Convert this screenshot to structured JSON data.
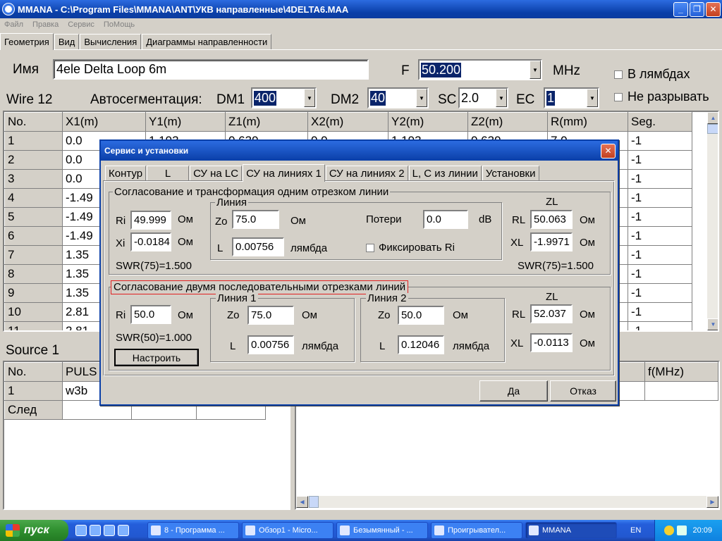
{
  "window": {
    "title": "MMANA - C:\\Program Files\\MMANA\\ANT\\УКВ направленные\\4DELTA6.MAA"
  },
  "menu": [
    "Файл",
    "Правка",
    "Сервис",
    "ПоМощь"
  ],
  "tabs": [
    "Геометрия",
    "Вид",
    "Вычисления",
    "Диаграммы направленности"
  ],
  "geometry": {
    "name_label": "Имя",
    "name_value": "4ele Delta Loop 6m",
    "f_label": "F",
    "f_value": "50.200",
    "f_unit": "MHz",
    "lambda_check": "В лямбдах",
    "nobreak_check": "Не разрывать",
    "wire_label": "Wire 12",
    "autoseg_label": "Автосегментация:",
    "dm1_label": "DM1",
    "dm1_value": "400",
    "dm2_label": "DM2",
    "dm2_value": "40",
    "sc_label": "SC",
    "sc_value": "2.0",
    "ec_label": "EC",
    "ec_value": "1"
  },
  "wire_table": {
    "headers": [
      "No.",
      "X1(m)",
      "Y1(m)",
      "Z1(m)",
      "X2(m)",
      "Y2(m)",
      "Z2(m)",
      "R(mm)",
      "Seg."
    ],
    "rows": [
      [
        "1",
        "0.0",
        "1.193",
        "0.639",
        "0.0",
        "1.193",
        "0.639",
        "7.0",
        "-1"
      ],
      [
        "2",
        "0.0",
        "",
        "",
        "",
        "",
        "",
        "",
        "-1"
      ],
      [
        "3",
        "0.0",
        "",
        "",
        "",
        "",
        "",
        "",
        "-1"
      ],
      [
        "4",
        "-1.49",
        "",
        "",
        "",
        "",
        "",
        "",
        "-1"
      ],
      [
        "5",
        "-1.49",
        "",
        "",
        "",
        "",
        "",
        "",
        "-1"
      ],
      [
        "6",
        "-1.49",
        "",
        "",
        "",
        "",
        "",
        "",
        "-1"
      ],
      [
        "7",
        "1.35",
        "",
        "",
        "",
        "",
        "",
        "",
        "-1"
      ],
      [
        "8",
        "1.35",
        "",
        "",
        "",
        "",
        "",
        "",
        "-1"
      ],
      [
        "9",
        "1.35",
        "",
        "",
        "",
        "",
        "",
        "",
        "-1"
      ],
      [
        "10",
        "2.81",
        "",
        "",
        "",
        "",
        "",
        "",
        "-1"
      ],
      [
        "11",
        "2.81",
        "",
        "",
        "",
        "",
        "",
        "",
        "-1"
      ]
    ]
  },
  "source": {
    "label": "Source 1",
    "headers": [
      "No.",
      "PULS"
    ],
    "rows": [
      [
        "1",
        "w3b"
      ]
    ],
    "next_label": "След"
  },
  "load_table": {
    "header_right": "f(MHz)"
  },
  "dialog": {
    "title": "Сервис и установки",
    "tabs": [
      "Контур",
      "L",
      "СУ на LC",
      "СУ на линиях 1",
      "СУ на линиях 2",
      "L, C из линии",
      "Установки"
    ],
    "group1": {
      "title": "Согласование и  трансформация одним отрезком линии",
      "ri_label": "Ri",
      "ri_value": "49.999",
      "ri_unit": "Ом",
      "xi_label": "Xi",
      "xi_value": "-0.0184",
      "xi_unit": "Ом",
      "swr_left": "SWR(75)=1.500",
      "line_title": "Линия",
      "zo_label": "Zo",
      "zo_value": "75.0",
      "zo_unit": "Ом",
      "l_label": "L",
      "l_value": "0.00756",
      "l_unit": "лямбда",
      "loss_label": "Потери",
      "loss_value": "0.0",
      "loss_unit": "dB",
      "fix_label": "Фиксировать Ri",
      "zl_title": "ZL",
      "rl_label": "RL",
      "rl_value": "50.063",
      "rl_unit": "Ом",
      "xl_label": "XL",
      "xl_value": "-1.9971",
      "xl_unit": "Ом",
      "swr_right": "SWR(75)=1.500"
    },
    "group2": {
      "title": "Согласование двумя последовательными отрезками линий",
      "ri_label": "Ri",
      "ri_value": "50.0",
      "ri_unit": "Ом",
      "swr": "SWR(50)=1.000",
      "tune_button": "Настроить",
      "line1_title": "Линия 1",
      "l1_zo_label": "Zo",
      "l1_zo_value": "75.0",
      "l1_zo_unit": "Ом",
      "l1_l_label": "L",
      "l1_l_value": "0.00756",
      "l1_l_unit": "лямбда",
      "line2_title": "Линия 2",
      "l2_zo_label": "Zo",
      "l2_zo_value": "50.0",
      "l2_zo_unit": "Ом",
      "l2_l_label": "L",
      "l2_l_value": "0.12046",
      "l2_l_unit": "лямбда",
      "zl_title": "ZL",
      "rl_label": "RL",
      "rl_value": "52.037",
      "rl_unit": "Ом",
      "xl_label": "XL",
      "xl_value": "-0.0113",
      "xl_unit": "Ом"
    },
    "ok_button": "Да",
    "cancel_button": "Отказ"
  },
  "taskbar": {
    "start": "пуск",
    "tasks": [
      "8 - Программа ...",
      "Обзор1 - Micro...",
      "Безымянный - ...",
      "Проигрывател...",
      "MMANA"
    ],
    "lang": "EN",
    "time": "20:09"
  },
  "colors": {
    "titlebar": "#0a3fa8",
    "highlight": "#0a246a",
    "focus_rect": "#e02020"
  }
}
